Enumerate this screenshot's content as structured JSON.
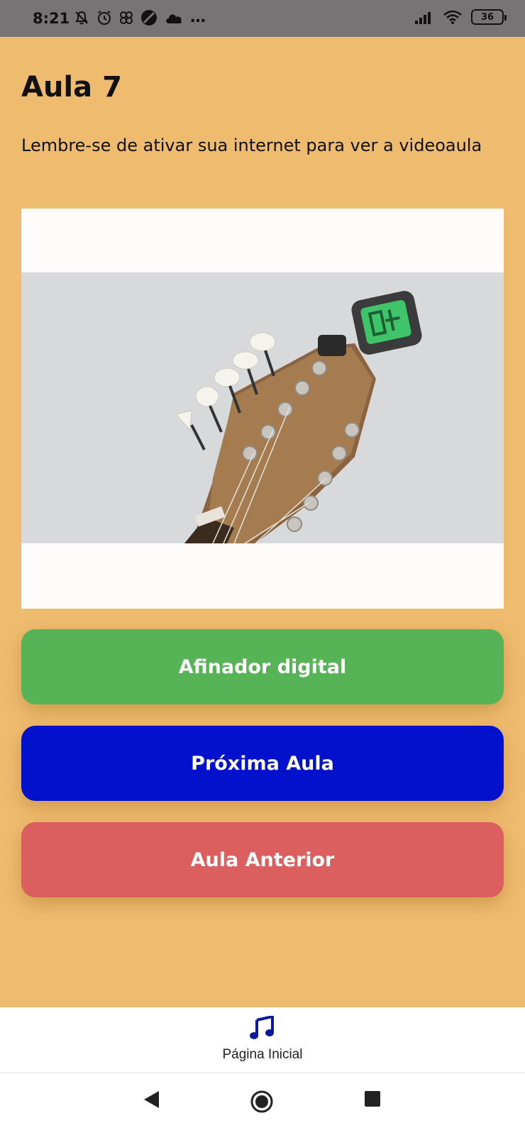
{
  "status_bar": {
    "time": "8:21",
    "more_indicator": "…",
    "battery_level": "36",
    "icons": [
      "bell-off-icon",
      "alarm-icon",
      "pinwheel-icon",
      "no-entry-icon",
      "cloud-icon",
      "signal-icon",
      "wifi-icon",
      "battery-icon"
    ]
  },
  "lesson": {
    "title": "Aula 7",
    "note": "Lembre-se de ativar sua internet para ver a videoaula"
  },
  "video": {
    "thumbnail": "guitar-headstock-with-clip-tuner"
  },
  "buttons": {
    "tuner": "Afinador digital",
    "next": "Próxima Aula",
    "previous": "Aula Anterior"
  },
  "bottom_nav": {
    "home_label": "Página Inicial",
    "home_icon": "music-note-icon"
  },
  "colors": {
    "background": "#efbb6e",
    "tuner_button": "#56b356",
    "next_button": "#0212cc",
    "previous_button": "#dc5f5f",
    "nav_icon": "#0a1aa0"
  }
}
